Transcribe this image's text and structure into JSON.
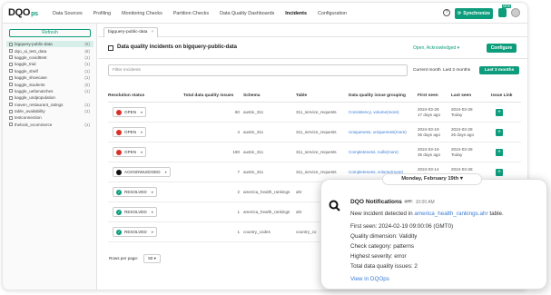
{
  "logo": {
    "text": "DQO",
    "suffix": "ps"
  },
  "nav": [
    "Data Sources",
    "Profiling",
    "Monitoring Checks",
    "Partition Checks",
    "Data Quality Dashboards",
    "Incidents",
    "Configuration"
  ],
  "nav_active": "Incidents",
  "topbar": {
    "help_icon": "?",
    "sync_label": "Synchronize",
    "badge": "NEW"
  },
  "sidebar": {
    "refresh_label": "Refresh",
    "items": [
      {
        "name": "bigquery-public-data",
        "count": "(8)",
        "selected": true
      },
      {
        "name": "dqo_ai_test_data",
        "count": "(8)"
      },
      {
        "name": "kaggle_covidttest",
        "count": "(1)"
      },
      {
        "name": "kaggle_trial",
        "count": "(1)"
      },
      {
        "name": "kaggle_shelf",
        "count": "(1)"
      },
      {
        "name": "kaggle_shoecase",
        "count": "(1)"
      },
      {
        "name": "kaggle_students",
        "count": "(2)"
      },
      {
        "name": "kaggle_uefamatches",
        "count": "(1)"
      },
      {
        "name": "kaggle_undpopulation",
        "count": ""
      },
      {
        "name": "maven_restaurant_ratings",
        "count": "(1)"
      },
      {
        "name": "table_availability",
        "count": "(1)"
      },
      {
        "name": "testconnection",
        "count": ""
      },
      {
        "name": "thelook_ecommerce",
        "count": "(1)"
      }
    ]
  },
  "tab": {
    "label": "bigquery-public-data",
    "close": "×"
  },
  "header": {
    "title": "Data quality incidents on bigquery-public-data",
    "status_filter": "Open, Acknowledged",
    "configure_label": "Configure"
  },
  "filters": {
    "placeholder": "Filter incidents",
    "current_month": "Current month",
    "last_2_months": "Last 2 months",
    "last_3_months": "Last 3 months"
  },
  "table": {
    "headers": [
      "Resolution status",
      "Total data quality issues",
      "Schema",
      "Table",
      "Data quality issue grouping",
      "First seen",
      "Last seen",
      "Issue Link"
    ],
    "rows": [
      {
        "status": "OPEN",
        "dot": "red",
        "issues": "60",
        "schema": "austin_311",
        "table": "311_service_requests",
        "grouping": "Consistency, volume(more)",
        "first_seen": "2024-03-28",
        "first_ago": "17 days ago",
        "last_seen": "2024-03-28",
        "last_ago": "Today"
      },
      {
        "status": "OPEN",
        "dot": "red",
        "issues": "4",
        "schema": "austin_311",
        "table": "311_service_requests",
        "grouping": "Uniqueness, uniqueness(more)",
        "first_seen": "2024-03-19",
        "first_ago": "36 days ago",
        "last_seen": "2024-03-28",
        "last_ago": "26 days ago"
      },
      {
        "status": "OPEN",
        "dot": "red",
        "issues": "190",
        "schema": "austin_311",
        "table": "311_service_requests",
        "grouping": "Completeness, nulls(more)",
        "first_seen": "2024-03-19",
        "first_ago": "35 days ago",
        "last_seen": "2024-03-28",
        "last_ago": "Today"
      },
      {
        "status": "ACKNOWLEDGED",
        "dot": "black",
        "issues": "7",
        "schema": "austin_311",
        "table": "311_service_requests",
        "grouping": "Completeness, volume(more)",
        "first_seen": "2024-03-14",
        "first_ago": "40 days ago",
        "last_seen": "2024-03-28",
        "last_ago": "Today"
      },
      {
        "status": "RESOLVED",
        "dot": "green",
        "issues": "2",
        "schema": "america_health_rankings",
        "table": "ahr",
        "grouping": "",
        "first_seen": "",
        "first_ago": "",
        "last_seen": "",
        "last_ago": ""
      },
      {
        "status": "RESOLVED",
        "dot": "green",
        "issues": "1",
        "schema": "america_health_rankings",
        "table": "ahr",
        "grouping": "",
        "first_seen": "",
        "first_ago": "",
        "last_seen": "",
        "last_ago": ""
      },
      {
        "status": "RESOLVED",
        "dot": "green",
        "issues": "1",
        "schema": "country_codes",
        "table": "country_co",
        "grouping": "",
        "first_seen": "",
        "first_ago": "",
        "last_seen": "",
        "last_ago": ""
      }
    ]
  },
  "pager": {
    "label": "Rows per page:",
    "value": "50"
  },
  "notification": {
    "date": "Monday, February 19th",
    "sender": "DQO Notifications",
    "app_badge": "APP",
    "time": "10:00 AM",
    "intro_prefix": "New incident detected in ",
    "intro_link": "america_health_rankings.ahr",
    "intro_suffix": " table.",
    "first_seen": "First seen: 2024-02-19 09:00:06 (GMT0)",
    "dimension": "Quality dimension: Validity",
    "category": "Check category: patterns",
    "severity": "Highest severity: error",
    "total": "Total data quality issues: 2",
    "view_link": "View in DQOps"
  }
}
